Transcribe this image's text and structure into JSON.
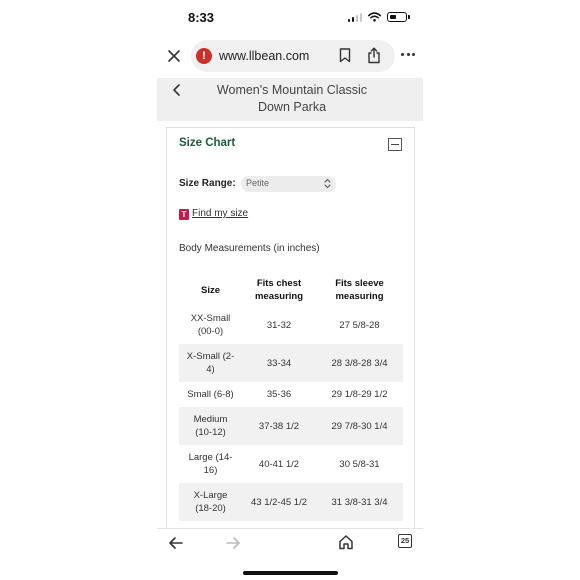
{
  "status_bar": {
    "time": "8:33"
  },
  "browser": {
    "url": "www.llbean.com",
    "tab_count": "25"
  },
  "product": {
    "title_line1": "Women's Mountain Classic",
    "title_line2": "Down Parka"
  },
  "size_chart": {
    "title": "Size Chart",
    "size_range_label": "Size Range:",
    "size_range_value": "Petite",
    "fit_icon_letter": "T",
    "find_my_size_label": "Find my size",
    "body_measurements_label": "Body Measurements (in inches)",
    "columns": {
      "size": "Size",
      "chest_line1": "Fits chest",
      "chest_line2": "measuring",
      "sleeve_line1": "Fits sleeve",
      "sleeve_line2": "measuring"
    },
    "rows": [
      {
        "size_line1": "XX-Small",
        "size_line2": "(00-0)",
        "chest": "31-32",
        "sleeve": "27 5/8-28"
      },
      {
        "size_line1": "X-Small (2-",
        "size_line2": "4)",
        "chest": "33-34",
        "sleeve": "28 3/8-28 3/4"
      },
      {
        "size_line1": "Small (6-8)",
        "size_line2": "",
        "chest": "35-36",
        "sleeve": "29 1/8-29 1/2"
      },
      {
        "size_line1": "Medium",
        "size_line2": "(10-12)",
        "chest": "37-38 1/2",
        "sleeve": "29 7/8-30 1/4"
      },
      {
        "size_line1": "Large (14-",
        "size_line2": "16)",
        "chest": "40-41 1/2",
        "sleeve": "30 5/8-31"
      },
      {
        "size_line1": "X-Large",
        "size_line2": "(18-20)",
        "chest": "43 1/2-45 1/2",
        "sleeve": "31 3/8-31 3/4"
      }
    ]
  },
  "icons": {
    "close": "close-icon",
    "site_warning": "warning-icon",
    "bookmark": "bookmark-icon",
    "share": "share-icon",
    "more": "more-icon",
    "back": "chevron-left-icon",
    "collapse": "minus-icon",
    "nav_back": "arrow-left-icon",
    "nav_forward": "arrow-right-icon",
    "home": "home-icon",
    "tabs": "tabs-icon"
  },
  "colors": {
    "accent_green": "#1e5a37",
    "warning_red": "#c9302c",
    "fit_brand": "#c9184a",
    "header_bg": "#efefef",
    "row_alt_bg": "#f1f1f1"
  }
}
